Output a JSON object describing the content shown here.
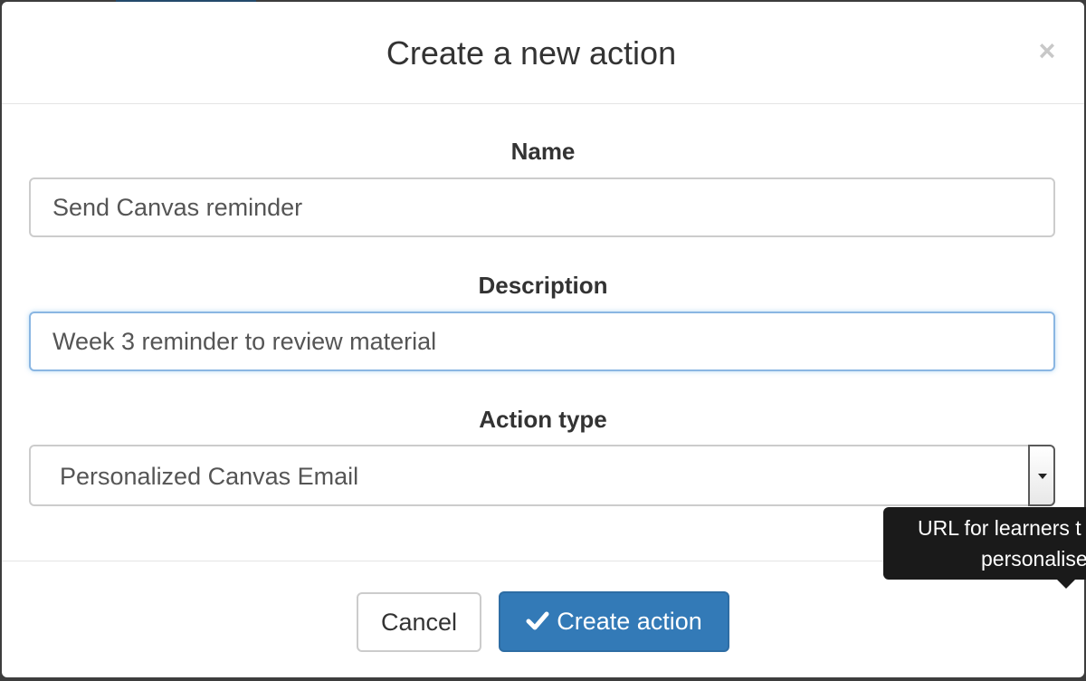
{
  "modal": {
    "title": "Create a new action",
    "close_label": "×"
  },
  "form": {
    "name": {
      "label": "Name",
      "value": "Send Canvas reminder"
    },
    "description": {
      "label": "Description",
      "value": "Week 3 reminder to review material"
    },
    "action_type": {
      "label": "Action type",
      "selected": "Personalized Canvas Email"
    }
  },
  "footer": {
    "cancel_label": "Cancel",
    "create_label": "Create action"
  },
  "tooltip": {
    "line1": "URL for learners t",
    "line2": "personalise"
  },
  "icons": {
    "close": "close-icon",
    "check": "check-icon",
    "dropdown": "chevron-down-icon"
  },
  "colors": {
    "primary": "#337ab7",
    "focus_border": "#8ab6e2",
    "tooltip_bg": "#1a1a1a"
  }
}
